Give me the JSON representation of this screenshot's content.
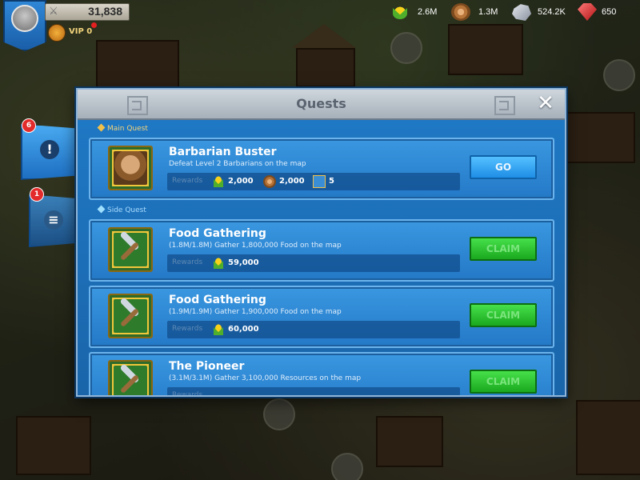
{
  "hud": {
    "power": "31,838",
    "vip": "VIP 0",
    "resources": [
      {
        "name": "food",
        "icon": "corn-icon",
        "value": "2.6M"
      },
      {
        "name": "wood",
        "icon": "wood-log-icon",
        "value": "1.3M"
      },
      {
        "name": "stone",
        "icon": "stone-icon",
        "value": "524.2K"
      },
      {
        "name": "gems",
        "icon": "gem-icon",
        "value": "650"
      }
    ]
  },
  "side_tabs": [
    {
      "name": "quests-tab",
      "icon": "exclamation-badge-icon",
      "badge": "6"
    },
    {
      "name": "mail-tab",
      "icon": "scroll-icon",
      "badge": "1"
    }
  ],
  "modal": {
    "title": "Quests",
    "main_section": "Main Quest",
    "side_section": "Side Quest",
    "rewards_label": "Rewards",
    "main_quest": {
      "title": "Barbarian Buster",
      "description": "Defeat Level 2 Barbarians on the map",
      "rewards": [
        {
          "icon": "corn-icon",
          "value": "2,000"
        },
        {
          "icon": "wood-log-icon",
          "value": "2,000"
        },
        {
          "icon": "tome-icon",
          "value": "5"
        }
      ],
      "button": "GO"
    },
    "side_quests": [
      {
        "title": "Food Gathering",
        "description": "(1.8M/1.8M) Gather 1,800,000 Food on the map",
        "reward": "59,000",
        "button": "CLAIM"
      },
      {
        "title": "Food Gathering",
        "description": "(1.9M/1.9M) Gather 1,900,000 Food on the map",
        "reward": "60,000",
        "button": "CLAIM"
      },
      {
        "title": "The Pioneer",
        "description": "(3.1M/3.1M) Gather 3,100,000 Resources on the map",
        "reward": "",
        "button": "CLAIM"
      }
    ]
  },
  "colors": {
    "accent": "#1c6eb8",
    "claim": "#1ba81f",
    "go": "#1e8ee6",
    "badge": "#e42b2b"
  }
}
